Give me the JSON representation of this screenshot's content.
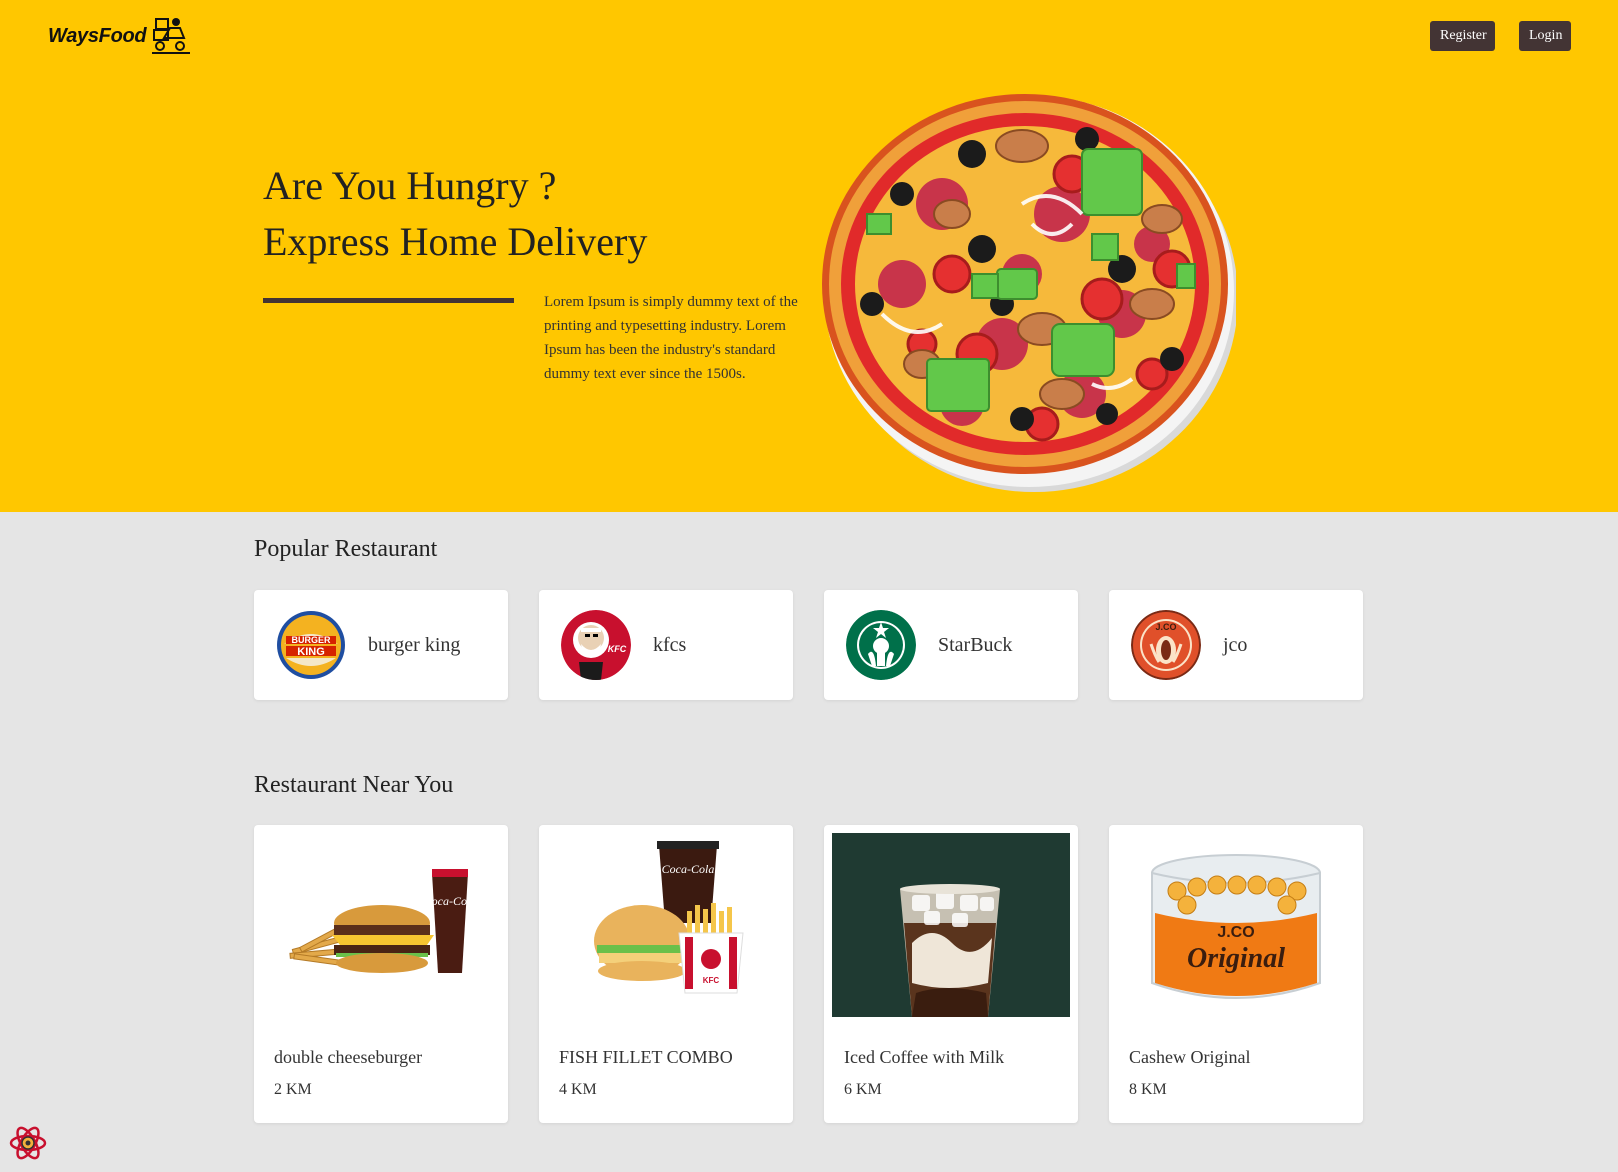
{
  "header": {
    "brand": "WaysFood",
    "register_label": "Register",
    "login_label": "Login"
  },
  "hero": {
    "line1": "Are You Hungry ?",
    "line2": "Express Home Delivery",
    "description": "Lorem Ipsum is simply dummy text of the printing and typesetting industry. Lorem Ipsum has been the industry's standard dummy text ever since the 1500s."
  },
  "popular": {
    "title": "Popular Restaurant",
    "items": [
      {
        "name": "burger king",
        "logo": "burger-king-logo"
      },
      {
        "name": "kfcs",
        "logo": "kfc-logo"
      },
      {
        "name": "StarBuck",
        "logo": "starbucks-logo"
      },
      {
        "name": "jco",
        "logo": "jco-logo"
      }
    ]
  },
  "near": {
    "title": "Restaurant Near You",
    "items": [
      {
        "name": "double cheeseburger",
        "distance": "2 KM",
        "image": "burger-combo-image"
      },
      {
        "name": "FISH FILLET COMBO",
        "distance": "4 KM",
        "image": "fish-combo-image"
      },
      {
        "name": "Iced Coffee with Milk",
        "distance": "6 KM",
        "image": "iced-coffee-image"
      },
      {
        "name": "Cashew Original",
        "distance": "8 KM",
        "image": "cashew-jar-image"
      }
    ]
  },
  "colors": {
    "hero_bg": "#FFC700",
    "page_bg": "#E5E5E5",
    "button_bg": "#433434"
  }
}
